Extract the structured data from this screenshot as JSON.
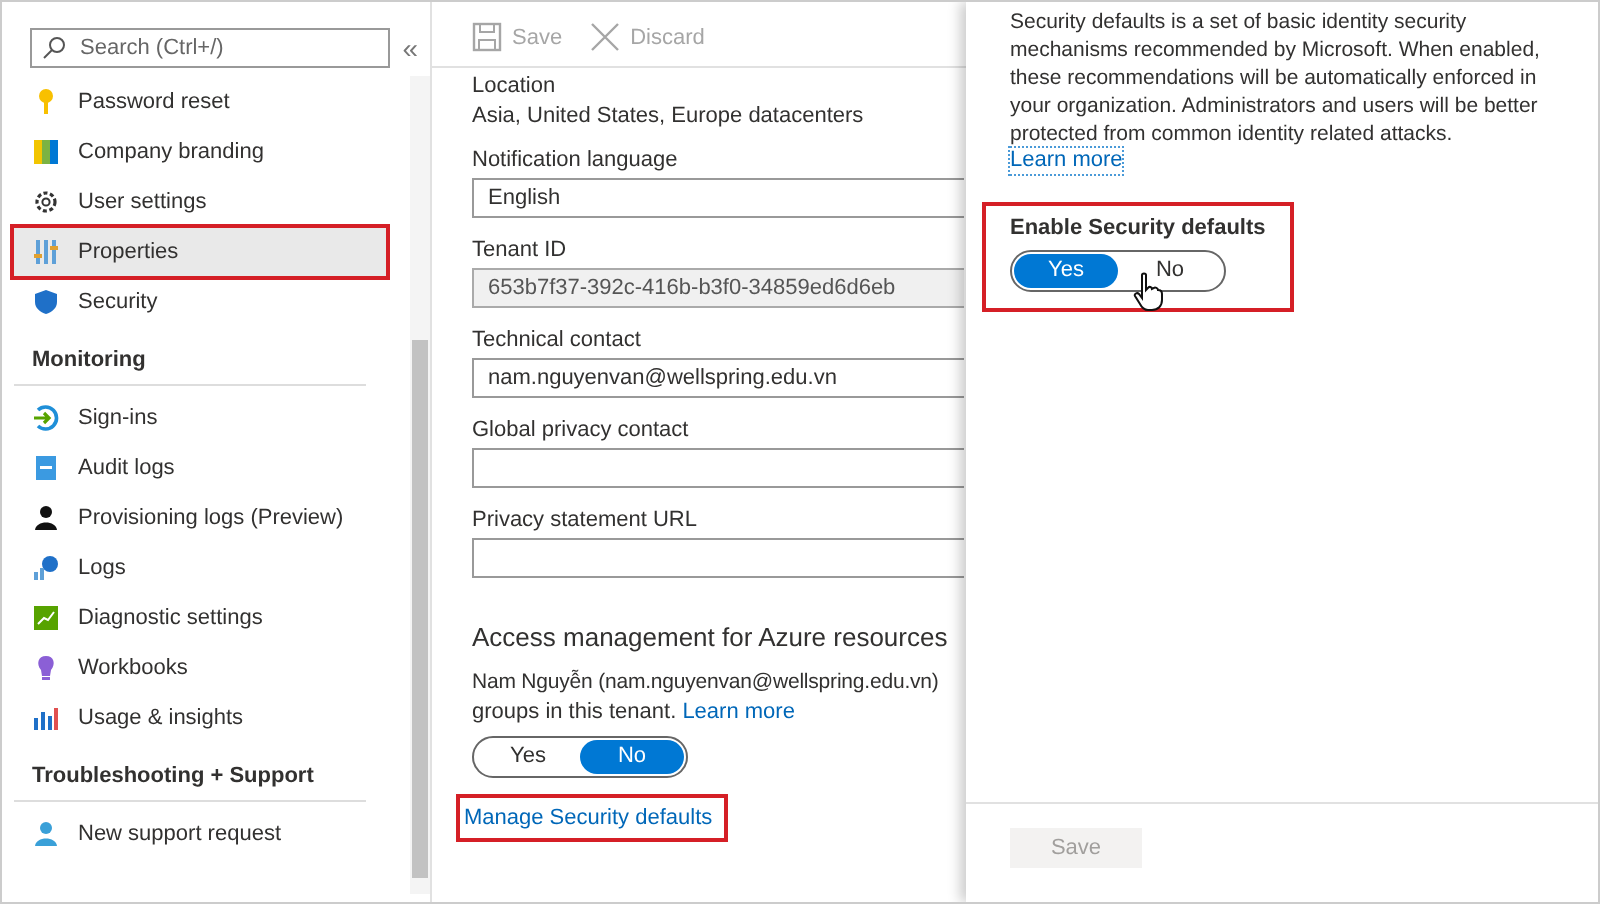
{
  "sidebar": {
    "search": {
      "placeholder": "Search (Ctrl+/)"
    },
    "collapse": "«",
    "sections": [
      {
        "items": [
          {
            "label": "Password reset",
            "selected": false,
            "highlighted": false
          },
          {
            "label": "Company branding",
            "selected": false,
            "highlighted": false
          },
          {
            "label": "User settings",
            "selected": false,
            "highlighted": false
          },
          {
            "label": "Properties",
            "selected": true,
            "highlighted": true
          },
          {
            "label": "Security",
            "selected": false,
            "highlighted": false
          }
        ]
      },
      {
        "title": "Monitoring",
        "items": [
          {
            "label": "Sign-ins",
            "selected": false,
            "highlighted": false
          },
          {
            "label": "Audit logs",
            "selected": false,
            "highlighted": false
          },
          {
            "label": "Provisioning logs (Preview)",
            "selected": false,
            "highlighted": false
          },
          {
            "label": "Logs",
            "selected": false,
            "highlighted": false
          },
          {
            "label": "Diagnostic settings",
            "selected": false,
            "highlighted": false
          },
          {
            "label": "Workbooks",
            "selected": false,
            "highlighted": false
          },
          {
            "label": "Usage & insights",
            "selected": false,
            "highlighted": false
          }
        ]
      },
      {
        "title": "Troubleshooting + Support",
        "items": [
          {
            "label": "New support request",
            "selected": false,
            "highlighted": false
          }
        ]
      }
    ]
  },
  "toolbar": [
    {
      "label": "Save",
      "disabled": true
    },
    {
      "label": "Discard",
      "disabled": true
    }
  ],
  "properties": {
    "location": {
      "label": "Location",
      "value": "Asia, United States, Europe datacenters"
    },
    "fields": [
      {
        "label": "Notification language",
        "value": "English",
        "disabled": false
      },
      {
        "label": "Tenant ID",
        "value": "653b7f37-392c-416b-b3f0-34859ed6d6eb",
        "disabled": true
      },
      {
        "label": "Technical contact",
        "value": "nam.nguyenvan@wellspring.edu.vn",
        "disabled": false
      },
      {
        "label": "Global privacy contact",
        "disabled": false
      },
      {
        "label": "Privacy statement URL",
        "disabled": false
      }
    ]
  },
  "access": {
    "heading": "Access management for Azure resources",
    "text_line1": "Nam Nguyễn (nam.nguyenvan@wellspring.edu.vn)",
    "text_line2": "groups in this tenant.",
    "link": "Learn more",
    "toggle": [
      {
        "label": "Yes",
        "selected": false
      },
      {
        "label": "No",
        "selected": true
      }
    ]
  },
  "manage_link": {
    "label": "Manage Security defaults",
    "highlighted": true
  },
  "panel": {
    "description": "Security defaults is a set of basic identity security mechanisms recommended by Microsoft. When enabled, these recommendations will be automatically enforced in your organization. Administrators and users will be better protected from common identity related attacks.",
    "link": "Learn more",
    "setting": {
      "label": "Enable Security defaults",
      "highlighted": true,
      "toggle": [
        {
          "label": "Yes",
          "selected": true
        },
        {
          "label": "No",
          "selected": false
        }
      ]
    },
    "save": {
      "label": "Save",
      "disabled": true
    }
  }
}
